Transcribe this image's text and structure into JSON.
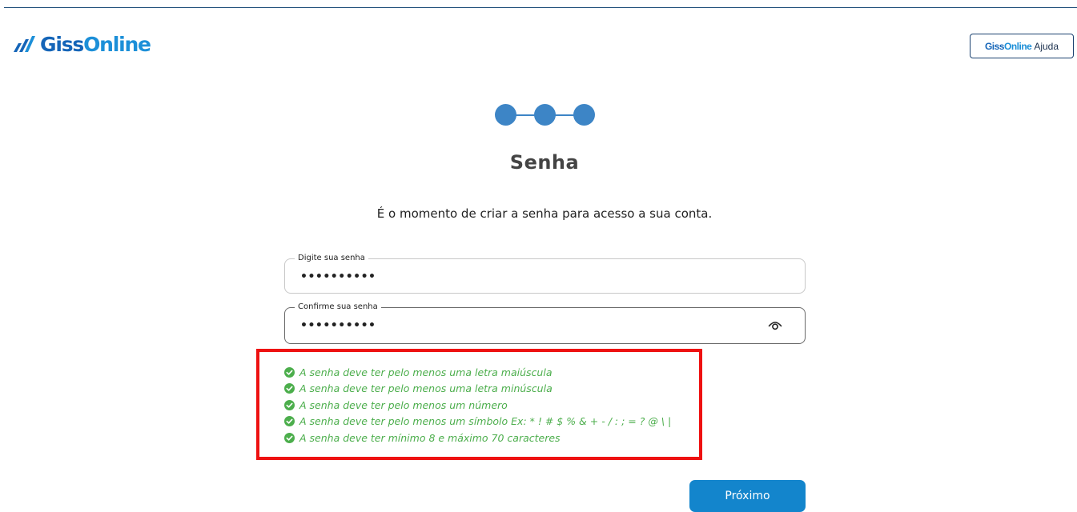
{
  "header": {
    "logo_text_1": "Giss",
    "logo_text_2": "Online",
    "help_button": {
      "brand_1": "Giss",
      "brand_2": "Online",
      "label": "Ajuda"
    }
  },
  "stepper": {
    "steps": 3,
    "completed": 3,
    "color": "#3d85c6"
  },
  "page": {
    "title": "Senha",
    "subtitle": "É o momento de criar a senha para acesso a sua conta."
  },
  "form": {
    "password": {
      "label": "Digite sua senha",
      "value": "••••••••••"
    },
    "confirm": {
      "label": "Confirme sua senha",
      "value": "••••••••••",
      "icon": "eye-icon"
    }
  },
  "rules": [
    "A senha deve ter pelo menos uma letra maiúscula",
    "A senha deve ter pelo menos uma letra minúscula",
    "A senha deve ter pelo menos um número",
    "A senha deve ter pelo menos um símbolo Ex: * ! # $ % & + - / : ; = ? @ \\ |",
    "A senha deve ter mínimo 8 e máximo 70 caracteres"
  ],
  "colors": {
    "brand_dark": "#1565b8",
    "brand_light": "#1c8fd8",
    "rule_ok": "#4cae4c",
    "highlight": "#ee1111",
    "button": "#1385cc"
  },
  "actions": {
    "next_label": "Próximo"
  }
}
